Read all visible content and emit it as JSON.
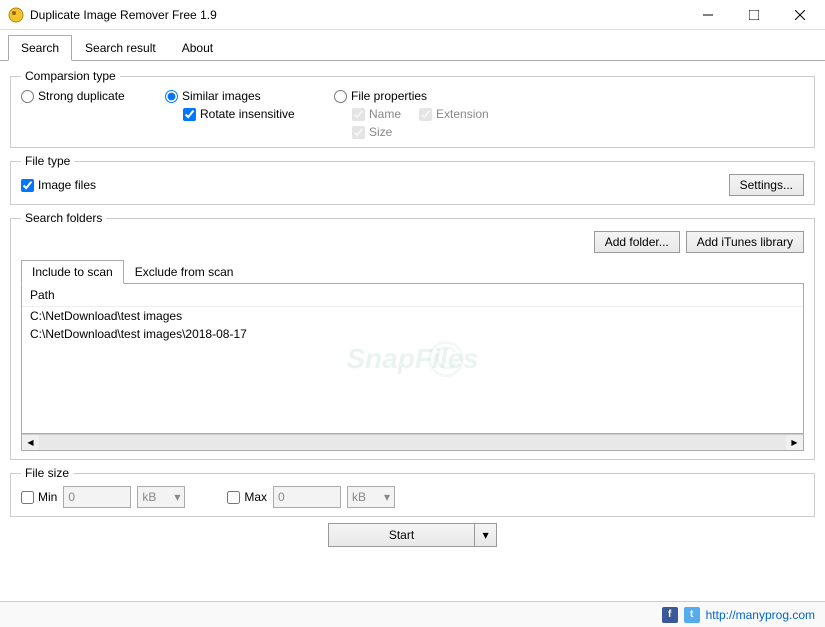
{
  "window": {
    "title": "Duplicate Image Remover Free 1.9"
  },
  "tabs": {
    "search": "Search",
    "search_result": "Search result",
    "about": "About"
  },
  "comparison": {
    "legend": "Comparsion type",
    "strong": "Strong duplicate",
    "similar": "Similar images",
    "rotate": "Rotate insensitive",
    "fileprops": "File properties",
    "name": "Name",
    "extension": "Extension",
    "size": "Size"
  },
  "filetype": {
    "legend": "File type",
    "image_files": "Image files",
    "settings_btn": "Settings..."
  },
  "folders": {
    "legend": "Search folders",
    "add_folder": "Add folder...",
    "add_itunes": "Add iTunes library",
    "include_tab": "Include to scan",
    "exclude_tab": "Exclude from scan",
    "path_header": "Path",
    "paths": [
      "C:\\NetDownload\\test images",
      "C:\\NetDownload\\test images\\2018-08-17"
    ]
  },
  "filesize": {
    "legend": "File size",
    "min": "Min",
    "max": "Max",
    "min_val": "0",
    "max_val": "0",
    "unit": "kB"
  },
  "start_btn": "Start",
  "footer": {
    "link": "http://manyprog.com"
  },
  "watermark": "SnapFiles"
}
